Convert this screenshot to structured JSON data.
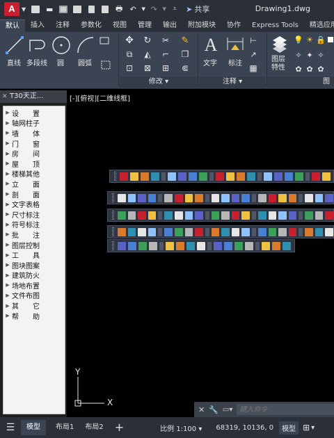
{
  "titlebar": {
    "logo_letter": "A",
    "share_label": "共享",
    "document_title": "Drawing1.dwg"
  },
  "tabs": [
    "默认",
    "插入",
    "注释",
    "参数化",
    "视图",
    "管理",
    "输出",
    "附加模块",
    "协作",
    "Express Tools",
    "精选应用"
  ],
  "active_tab": "默认",
  "ribbon": {
    "draw_tools": [
      "直线",
      "多段线",
      "圆",
      "圆弧"
    ],
    "modify_panel_label": "修改",
    "text_label": "文字",
    "dimension_label": "标注",
    "annotation_panel_label": "注释",
    "layer_properties_label": "图层\n特性",
    "layers_panel_label": "图"
  },
  "palette": {
    "title": "T30天正...",
    "items": [
      "设　　置",
      "轴网柱子",
      "墙　　体",
      "门　　窗",
      "房　　间",
      "屋　　顶",
      "楼梯其他",
      "立　　面",
      "剖　　面",
      "文字表格",
      "尺寸标注",
      "符号标注",
      "批　　注",
      "图层控制",
      "工　　具",
      "图块图案",
      "建筑防火",
      "场地布置",
      "文件布图",
      "其　　它",
      "帮　　助"
    ]
  },
  "viewport": {
    "view_label": "[-][俯视][二维线框]",
    "ucs_x": "X",
    "ucs_y": "Y"
  },
  "command_line": {
    "placeholder": "键入命令"
  },
  "statusbar": {
    "model_tab": "模型",
    "layout1_tab": "布局1",
    "layout2_tab": "布局2",
    "add_tab": "+",
    "scale": "比例 1:100",
    "coordinates": "68319, 10136, 0",
    "mode": "模型"
  },
  "colors": {
    "titlebar_bg": "#2b3038",
    "ribbon_bg": "#3b4453",
    "canvas_bg": "#000000",
    "logo_red": "#c8202f",
    "palette_list_bg": "#f3f3f3"
  }
}
